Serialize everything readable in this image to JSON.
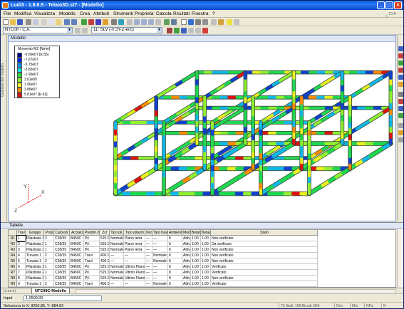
{
  "window": {
    "title": "Ludi3 - 1.8.0.5 - Telaio3D.st7 - [Modello]"
  },
  "menu": [
    "File",
    "Modifica",
    "Visualizza",
    "Modello",
    "Crea",
    "Attributi",
    "Strumenti",
    "Proprietà",
    "Calcola",
    "Risultati",
    "Finestra",
    "?"
  ],
  "toolbar": {
    "code_combo": "NTC08 - C.A.",
    "load_combo": "11: SLV (-0.3Y-Z-ecc)"
  },
  "left_strip_text": "Gestione dei modello",
  "viewport": {
    "title": "Modello",
    "legend": {
      "title": "Momento M2 [Nmm]",
      "items": [
        {
          "label": "-9.60e07 [E:55]",
          "color": "#00008c"
        },
        {
          "label": "-7.67e07",
          "color": "#0020ff"
        },
        {
          "label": "-5.75e07",
          "color": "#0090ff"
        },
        {
          "label": "-3.82e07",
          "color": "#00e8e0"
        },
        {
          "label": "-1.90e07",
          "color": "#20e040"
        },
        {
          "label": "3.02e05",
          "color": "#90f030"
        },
        {
          "label": "1.96e07",
          "color": "#f8f020"
        },
        {
          "label": "3.88e07",
          "color": "#ff8c00"
        },
        {
          "label": "5.81e07 [E:62]",
          "color": "#e01010"
        }
      ]
    },
    "axes": {
      "x": "X",
      "y": "Y",
      "z": "Z"
    }
  },
  "table": {
    "title": "Tabelle",
    "columns": [
      "Trave",
      "Gruppo",
      "Prop",
      "Calcestr.",
      "Acciaio",
      "Predim./Ver.",
      "Zcr",
      "Tipo pil.",
      "Tipo pilastri",
      "Nor",
      "Tipo trave",
      "Ambiente",
      "Mod",
      "Beta1",
      "Beta2",
      "Stato"
    ],
    "rows": [
      {
        "id": "R1",
        "cells": [
          "1",
          "Pilastrata 1",
          "2",
          "C28/35",
          "B450C",
          "Pil.",
          "525.00",
          "Normale",
          "Piano terra",
          "—",
          "—",
          "It",
          "Attivo",
          "1.00",
          "1.00",
          "Non verificato"
        ]
      },
      {
        "id": "R2",
        "cells": [
          "2",
          "Pilastrata 2",
          "1",
          "C28/35",
          "B450C",
          "Pil.",
          "525.00",
          "Normale",
          "Piano terra",
          "—",
          "—",
          "It",
          "Attivo",
          "1.00",
          "1.00",
          "Da verificare"
        ]
      },
      {
        "id": "R3",
        "cells": [
          "3",
          "Pilastrata 3",
          "1",
          "C28/35",
          "B450C",
          "Pil.",
          "525.00",
          "Normale",
          "Piano terra",
          "—",
          "—",
          "It",
          "Attivo",
          "1.00",
          "1.00",
          "Non verificato"
        ]
      },
      {
        "id": "R4",
        "cells": [
          "4",
          "Travata 1",
          "2",
          "C28/35",
          "B450C",
          "Travi",
          "400.00",
          "—",
          "—",
          "—",
          "Normale",
          "It",
          "Attivo",
          "1.00",
          "1.00",
          "Non verificato"
        ]
      },
      {
        "id": "R5",
        "cells": [
          "5",
          "Travata 1",
          "2",
          "C28/35",
          "B450C",
          "Travi",
          "400.00",
          "—",
          "—",
          "—",
          "Normale",
          "It",
          "Attivo",
          "1.00",
          "1.00",
          "Non verificato"
        ]
      },
      {
        "id": "R6",
        "cells": [
          "6",
          "Pilastrata 1",
          "1",
          "C28/35",
          "B450C",
          "Pil.",
          "525.00",
          "Normale",
          "Ultimo Piano",
          "—",
          "—",
          "It",
          "Attivo",
          "1.00",
          "1.00",
          "Verificato"
        ]
      },
      {
        "id": "R7",
        "cells": [
          "7",
          "Pilastrata 2",
          "1",
          "C28/35",
          "B450C",
          "Pil.",
          "525.00",
          "Normale",
          "Ultimo Piano",
          "—",
          "—",
          "It",
          "Attivo",
          "1.00",
          "1.00",
          "Verificato"
        ]
      },
      {
        "id": "R8",
        "cells": [
          "8",
          "Pilastrata 3",
          "1",
          "C28/35",
          "B450C",
          "Pil.",
          "525.00",
          "Normale",
          "Ultimo Piano",
          "—",
          "—",
          "It",
          "Attivo",
          "1.00",
          "1.00",
          "Non verificato"
        ]
      },
      {
        "id": "R9",
        "cells": [
          "9",
          "Travata 1",
          "2",
          "C28/35",
          "B450C",
          "Travi",
          "400.00",
          "—",
          "—",
          "—",
          "Normale",
          "It",
          "Attivo",
          "1.00",
          "1.00",
          "Verificato"
        ]
      }
    ],
    "sheet_tab": "NTC08C-Modello"
  },
  "input": {
    "label": "Input",
    "value": "1,2500.00"
  },
  "status": {
    "text": "Seleziona in X: 9250.85, Y: 884.82",
    "panels": [
      "73 Nodi: 108 Bicodi: 864",
      "Dim",
      "Mm",
      "NPa",
      "N"
    ]
  }
}
